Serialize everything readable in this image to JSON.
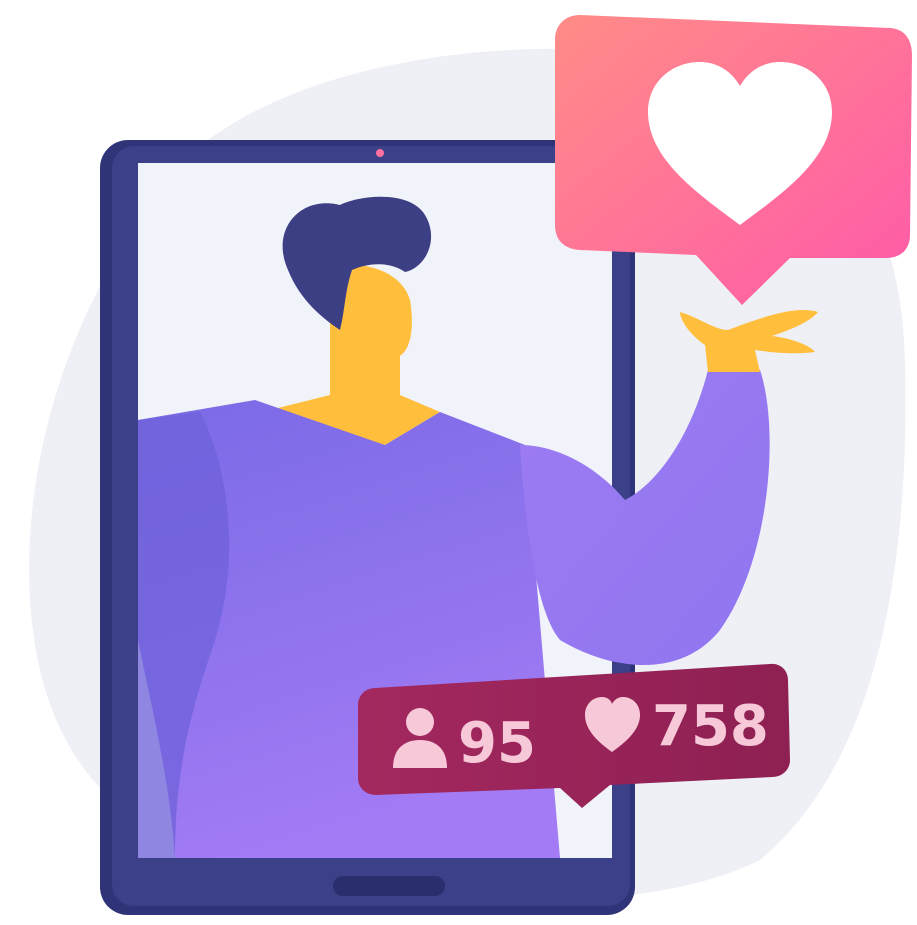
{
  "colors": {
    "background_blob": "#eef0f7",
    "tablet_frame": "#3a3f86",
    "tablet_frame_dark": "#2c3070",
    "tablet_screen": "#f2f4fa",
    "hair": "#3d3f85",
    "skin": "#ffbe3b",
    "shirt_light": "#a27cf4",
    "shirt_dark": "#6f63dc",
    "like_bubble_top": "#ff8a8a",
    "like_bubble_bottom": "#ff5fa8",
    "heart_white": "#ffffff",
    "stats_bubble": "#a4265c",
    "stats_text": "#f7c9d8"
  },
  "notification": {
    "like_icon": "heart-icon",
    "followers_icon": "user-icon",
    "followers_count": "95",
    "likes_icon": "heart-icon",
    "likes_count": "758"
  }
}
